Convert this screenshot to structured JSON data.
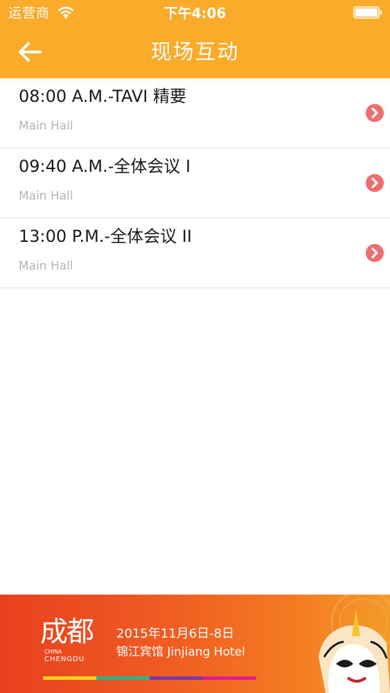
{
  "status_bar": {
    "carrier": "运营商",
    "time": "下午4:06",
    "wifi_icon": "wifi-icon",
    "battery_icon": "battery-icon"
  },
  "nav": {
    "back_icon": "arrow-left-icon",
    "title": "现场互动"
  },
  "sessions": [
    {
      "title": "08:00 A.M.-TAVI 精要",
      "venue": "Main Hall",
      "icon": "chevron-right-icon"
    },
    {
      "title": "09:40 A.M.-全体会议 I",
      "venue": "Main Hall",
      "icon": "chevron-right-icon"
    },
    {
      "title": "13:00 P.M.-全体会议 II",
      "venue": "Main Hall",
      "icon": "chevron-right-icon"
    }
  ],
  "banner": {
    "logo_text": "成都",
    "logo_china": "CHINA",
    "logo_chengdu": "CHENGDU",
    "date": "2015年11月6日-8日",
    "venue": "锦江宾馆 Jinjiang Hotel"
  },
  "colors": {
    "header_bg": "#fbab2a",
    "chevron": "#ec6e6e",
    "banner_start": "#e8401f",
    "banner_end": "#f39a2a"
  }
}
